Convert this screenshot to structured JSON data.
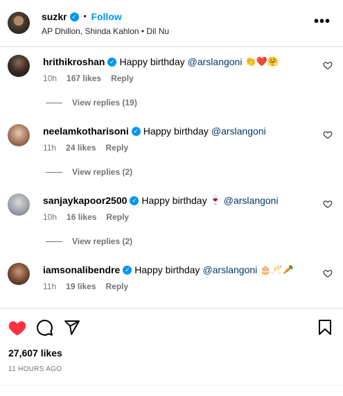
{
  "header": {
    "username": "suzkr",
    "separator": "•",
    "follow_label": "Follow",
    "subtitle": "AP Dhillon, Shinda Kahlon • Dil Nu",
    "more_label": "•••"
  },
  "comments": [
    {
      "username": "hrithikroshan",
      "text": "Happy birthday",
      "mention": "@arslangoni",
      "emoji": "👏❤️🤗",
      "time": "10h",
      "likes": "167 likes",
      "reply_label": "Reply",
      "view_replies": "View replies (19)"
    },
    {
      "username": "neelamkotharisoni",
      "text": "Happy birthday",
      "mention": "@arslangoni",
      "emoji": "",
      "time": "11h",
      "likes": "24 likes",
      "reply_label": "Reply",
      "view_replies": "View replies (2)"
    },
    {
      "username": "sanjaykapoor2500",
      "text": "Happy birthday",
      "text_emoji": "🍷",
      "mention": "@arslangoni",
      "emoji": "",
      "time": "10h",
      "likes": "16 likes",
      "reply_label": "Reply",
      "view_replies": "View replies (2)"
    },
    {
      "username": "iamsonalibendre",
      "text": "Happy birthday",
      "mention": "@arslangoni",
      "emoji": "🎂🥂🥕",
      "time": "11h",
      "likes": "19 likes",
      "reply_label": "Reply"
    }
  ],
  "post": {
    "likes": "27,607 likes",
    "time": "11 HOURS AGO",
    "liked": true,
    "like_color": "#ff3040"
  },
  "icons": {
    "like": "heart-filled-icon",
    "comment": "speech-bubble-icon",
    "share": "paper-plane-icon",
    "save": "bookmark-icon",
    "comment_like": "heart-outline-icon"
  }
}
